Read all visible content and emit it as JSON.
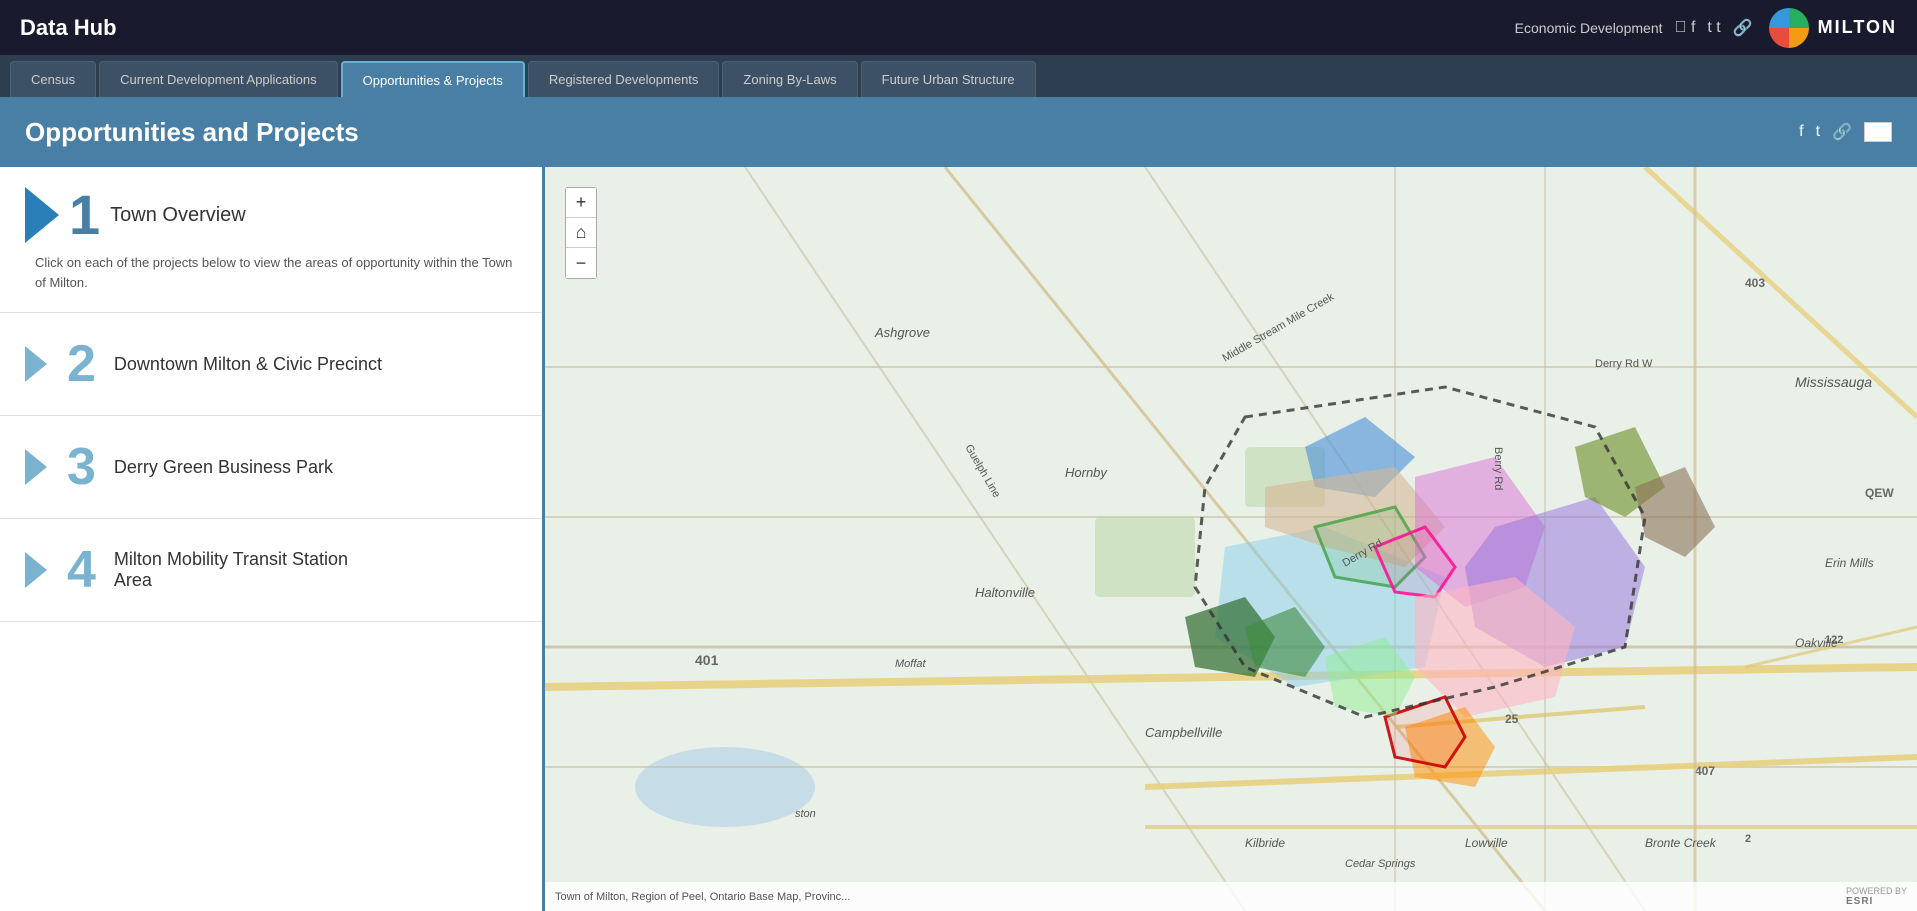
{
  "header": {
    "title": "Data Hub",
    "eco_dev_label": "Economic Development",
    "logo_text": "MILTON"
  },
  "nav": {
    "tabs": [
      {
        "label": "Census",
        "active": false
      },
      {
        "label": "Current Development Applications",
        "active": false
      },
      {
        "label": "Opportunities & Projects",
        "active": true
      },
      {
        "label": "Registered Developments",
        "active": false
      },
      {
        "label": "Zoning By-Laws",
        "active": false
      },
      {
        "label": "Future Urban Structure",
        "active": false
      }
    ]
  },
  "page": {
    "title": "Opportunities and Projects"
  },
  "sidebar": {
    "items": [
      {
        "number": "1",
        "title": "Town Overview",
        "description": "Click on each of the projects below to view the areas of opportunity within the Town of Milton.",
        "active": true
      },
      {
        "number": "2",
        "title": "Downtown Milton & Civic Precinct"
      },
      {
        "number": "3",
        "title": "Derry Green Business Park"
      },
      {
        "number": "4",
        "title": "Milton Mobility Transit Station Area"
      }
    ]
  },
  "map": {
    "attribution": "Town of Milton, Region of Peel, Ontario Base Map, Provinc...",
    "esri_label": "POWERED BY",
    "esri_name": "esri"
  },
  "controls": {
    "zoom_in": "+",
    "home": "⌂",
    "zoom_out": "−"
  }
}
